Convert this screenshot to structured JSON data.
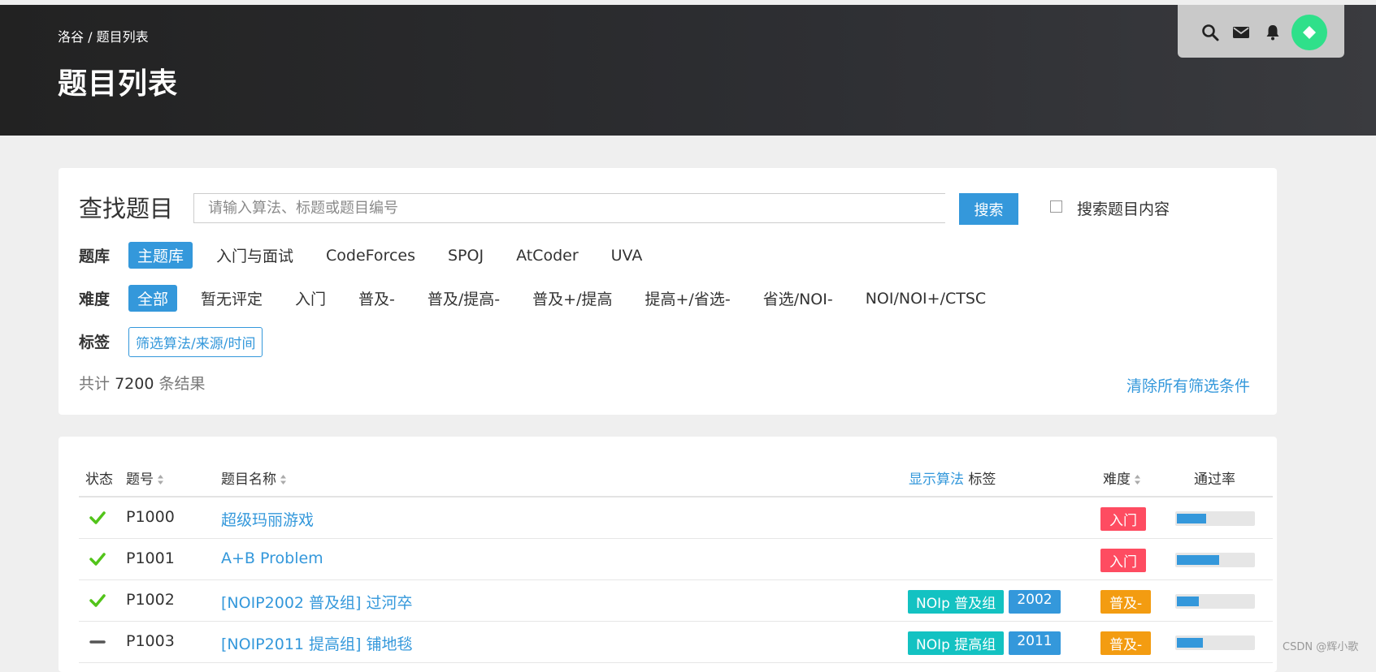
{
  "header": {
    "breadcrumb": "洛谷 / 题目列表",
    "title": "题目列表",
    "icons": [
      "search-icon",
      "mail-icon",
      "bell-icon",
      "avatar"
    ]
  },
  "search": {
    "title": "查找题目",
    "placeholder": "请输入算法、标题或题目编号",
    "button_label": "搜索",
    "content_checkbox_label": "搜索题目内容",
    "content_checkbox_checked": false
  },
  "filters": {
    "bank_label": "题库",
    "banks": [
      "主题库",
      "入门与面试",
      "CodeForces",
      "SPOJ",
      "AtCoder",
      "UVA"
    ],
    "bank_selected": "主题库",
    "difficulty_label": "难度",
    "difficulties": [
      "全部",
      "暂无评定",
      "入门",
      "普及-",
      "普及/提高-",
      "普及+/提高",
      "提高+/省选-",
      "省选/NOI-",
      "NOI/NOI+/CTSC"
    ],
    "difficulty_selected": "全部",
    "tags_label": "标签",
    "tags_button": "筛选算法/来源/时间",
    "count_prefix": "共计",
    "count": "7200",
    "count_suffix": "条结果",
    "clear_label": "清除所有筛选条件"
  },
  "table": {
    "headers": {
      "status": "状态",
      "id": "题号",
      "name": "题目名称",
      "show_alg": "显示算法",
      "tags": "标签",
      "difficulty": "难度",
      "pass_rate": "通过率"
    },
    "rows": [
      {
        "status": "check-icon",
        "id": "P1000",
        "title": "超级玛丽游戏",
        "tags": [],
        "difficulty": "入门",
        "difficulty_color": "#fe4c61",
        "pass_rate": 0.38
      },
      {
        "status": "check-icon",
        "id": "P1001",
        "title": "A+B Problem",
        "tags": [],
        "difficulty": "入门",
        "difficulty_color": "#fe4c61",
        "pass_rate": 0.55
      },
      {
        "status": "check-icon",
        "id": "P1002",
        "title": "[NOIP2002 普及组] 过河卒",
        "tags": [
          {
            "text": "NOIp 普及组",
            "color": "#13c2c2"
          },
          {
            "text": "2002",
            "color": "#3498db"
          }
        ],
        "difficulty": "普及-",
        "difficulty_color": "#f39c11",
        "pass_rate": 0.29
      },
      {
        "status": "dash-icon",
        "id": "P1003",
        "title": "[NOIP2011 提高组] 铺地毯",
        "tags": [
          {
            "text": "NOIp 提高组",
            "color": "#13c2c2"
          },
          {
            "text": "2011",
            "color": "#3498db"
          }
        ],
        "difficulty": "普及-",
        "difficulty_color": "#f39c11",
        "pass_rate": 0.34
      }
    ]
  },
  "watermark": "CSDN @辉小歌"
}
